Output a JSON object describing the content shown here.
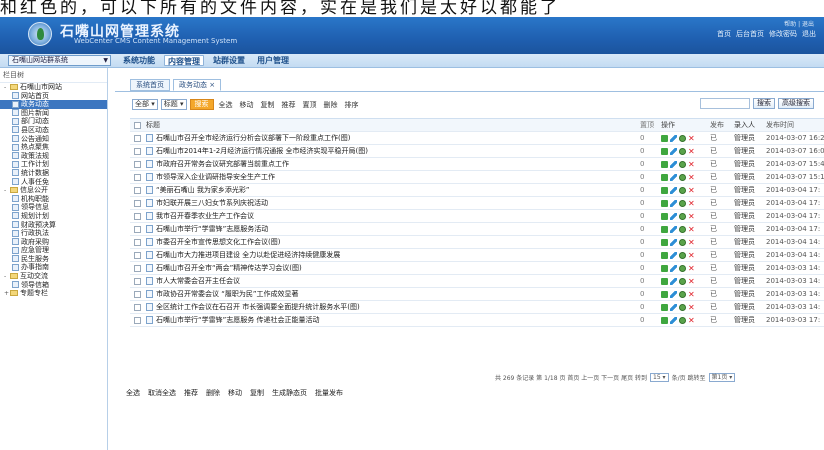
{
  "banner": {
    "text": "和红色的，可以下所有的文件内容，实在是我们是太好以都能了"
  },
  "header": {
    "app_title": "石嘴山网管理系统",
    "app_subtitle": "WebCenter CMS Content Management System",
    "top_note": "帮助 | 退出",
    "links": [
      "首页",
      "后台首页",
      "修改密码",
      "退出"
    ]
  },
  "nav": {
    "site_select": "石嘴山网站群系统",
    "items": [
      {
        "label": "系统功能",
        "active": false
      },
      {
        "label": "内容管理",
        "active": true
      },
      {
        "label": "站群设置",
        "active": false
      },
      {
        "label": "用户管理",
        "active": false
      }
    ]
  },
  "sidebar": {
    "heading": "栏目树",
    "items": [
      {
        "label": "石嘴山市网站",
        "type": "folder",
        "toggle": "-"
      },
      {
        "label": "网站首页",
        "type": "doc"
      },
      {
        "label": "政务动态",
        "type": "doc",
        "selected": true
      },
      {
        "label": "图片新闻",
        "type": "doc"
      },
      {
        "label": "部门动态",
        "type": "doc"
      },
      {
        "label": "县区动态",
        "type": "doc"
      },
      {
        "label": "公告通知",
        "type": "doc"
      },
      {
        "label": "热点聚焦",
        "type": "doc"
      },
      {
        "label": "政策法规",
        "type": "doc"
      },
      {
        "label": "工作计划",
        "type": "doc"
      },
      {
        "label": "统计数据",
        "type": "doc"
      },
      {
        "label": "人事任免",
        "type": "doc"
      },
      {
        "label": "信息公开",
        "type": "folder",
        "toggle": "-"
      },
      {
        "label": "机构职能",
        "type": "doc"
      },
      {
        "label": "领导信息",
        "type": "doc"
      },
      {
        "label": "规划计划",
        "type": "doc"
      },
      {
        "label": "财政预决算",
        "type": "doc"
      },
      {
        "label": "行政执法",
        "type": "doc"
      },
      {
        "label": "政府采购",
        "type": "doc"
      },
      {
        "label": "应急管理",
        "type": "doc"
      },
      {
        "label": "民生服务",
        "type": "doc"
      },
      {
        "label": "办事指南",
        "type": "doc"
      },
      {
        "label": "互动交流",
        "type": "folder",
        "toggle": "-"
      },
      {
        "label": "领导信箱",
        "type": "doc"
      },
      {
        "label": "专题专栏",
        "type": "folder",
        "toggle": "+"
      }
    ]
  },
  "tabs": [
    {
      "label": "系统首页",
      "active": false
    },
    {
      "label": "政务动态 ×",
      "active": true
    }
  ],
  "toolbar": {
    "select_a": "全部 ▾",
    "select_b": "标题 ▾",
    "search_btn": "搜索",
    "links": [
      "全选",
      "移动",
      "复制",
      "推荐",
      "置顶",
      "删除",
      "排序"
    ],
    "right_search_btn": "搜索",
    "right_advanced_btn": "高级搜索"
  },
  "grid": {
    "headers": {
      "title": "标题",
      "top": "置顶",
      "actions": "操作",
      "pub": "发布",
      "user": "录入人",
      "time": "发布时间"
    },
    "rows": [
      {
        "title": "石嘴山市召开全市经济运行分析会议部署下一阶段重点工作(图)",
        "top": "0",
        "pub": "已",
        "user": "管理员",
        "time": "2014-03-07 16:2"
      },
      {
        "title": "石嘴山市2014年1-2月经济运行情况通报 全市经济实现平稳开局(图)",
        "top": "0",
        "pub": "已",
        "user": "管理员",
        "time": "2014-03-07 16:0"
      },
      {
        "title": "市政府召开常务会议研究部署当前重点工作",
        "top": "0",
        "pub": "已",
        "user": "管理员",
        "time": "2014-03-07 15:4"
      },
      {
        "title": "市领导深入企业调研指导安全生产工作",
        "top": "0",
        "pub": "已",
        "user": "管理员",
        "time": "2014-03-07 15:1"
      },
      {
        "title": "“美丽石嘴山 我为家乡添光彩”",
        "top": "0",
        "pub": "已",
        "user": "管理员",
        "time": "2014-03-04 17:"
      },
      {
        "title": "市妇联开展三八妇女节系列庆祝活动",
        "top": "0",
        "pub": "已",
        "user": "管理员",
        "time": "2014-03-04 17:"
      },
      {
        "title": "我市召开春季农业生产工作会议",
        "top": "0",
        "pub": "已",
        "user": "管理员",
        "time": "2014-03-04 17:"
      },
      {
        "title": "石嘴山市举行“学雷锋”志愿服务活动",
        "top": "0",
        "pub": "已",
        "user": "管理员",
        "time": "2014-03-04 17:"
      },
      {
        "title": "市委召开全市宣传思想文化工作会议(图)",
        "top": "0",
        "pub": "已",
        "user": "管理员",
        "time": "2014-03-04 14:"
      },
      {
        "title": "石嘴山市大力推进项目建设 全力以赴促进经济持续健康发展",
        "top": "0",
        "pub": "已",
        "user": "管理员",
        "time": "2014-03-04 14:"
      },
      {
        "title": "石嘴山市召开全市“两会”精神传达学习会议(图)",
        "top": "0",
        "pub": "已",
        "user": "管理员",
        "time": "2014-03-03 14:"
      },
      {
        "title": "市人大常委会召开主任会议",
        "top": "0",
        "pub": "已",
        "user": "管理员",
        "time": "2014-03-03 14:"
      },
      {
        "title": "市政协召开常委会议 “履职为民”工作成效显著",
        "top": "0",
        "pub": "已",
        "user": "管理员",
        "time": "2014-03-03 14:"
      },
      {
        "title": "全区统计工作会议在石召开 市长强调要全面提升统计服务水平(图)",
        "top": "0",
        "pub": "已",
        "user": "管理员",
        "time": "2014-03-03 14:"
      },
      {
        "title": "石嘴山市举行“学雷锋”志愿服务 传递社会正能量活动",
        "top": "0",
        "pub": "已",
        "user": "管理员",
        "time": "2014-03-03 17:"
      }
    ]
  },
  "pager": {
    "text": "共 269 条记录 第 1/18 页 首页 上一页 下一页 尾页 转到",
    "per_page": "15 ▾",
    "goto_label": "条/页 跳转至",
    "goto_select": "第1页 ▾"
  },
  "bottom_actions": [
    "全选",
    "取消全选",
    "推荐",
    "删除",
    "移动",
    "复制",
    "生成静态页",
    "批量发布"
  ]
}
